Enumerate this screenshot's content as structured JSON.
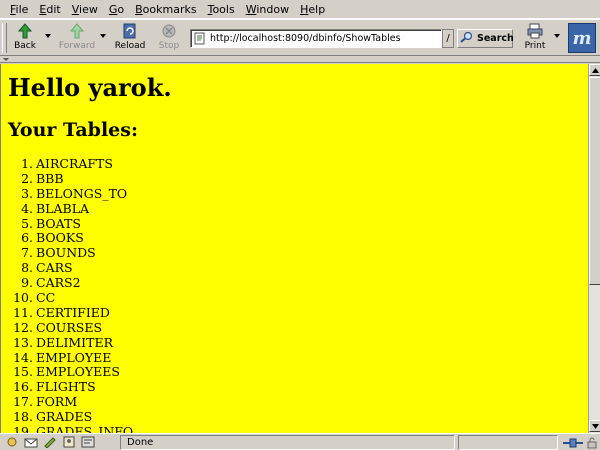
{
  "menu": [
    "File",
    "Edit",
    "View",
    "Go",
    "Bookmarks",
    "Tools",
    "Window",
    "Help"
  ],
  "menu_access_keys": [
    "F",
    "E",
    "V",
    "G",
    "B",
    "T",
    "W",
    "H"
  ],
  "toolbar": {
    "back_label": "Back",
    "forward_label": "Forward",
    "reload_label": "Reload",
    "stop_label": "Stop",
    "search_label": "Search",
    "print_label": "Print"
  },
  "address": {
    "url": "http://localhost:8090/dbinfo/ShowTables"
  },
  "page": {
    "heading": "Hello yarok.",
    "subheading": "Your Tables:",
    "tables": [
      "AIRCRAFTS",
      "BBB",
      "BELONGS_TO",
      "BLABLA",
      "BOATS",
      "BOOKS",
      "BOUNDS",
      "CARS",
      "CARS2",
      "CC",
      "CERTIFIED",
      "COURSES",
      "DELIMITER",
      "EMPLOYEE",
      "EMPLOYEES",
      "FLIGHTS",
      "FORM",
      "GRADES",
      "GRADES_INFO"
    ]
  },
  "status": {
    "text": "Done"
  },
  "colors": {
    "page_background": "#ffff00",
    "chrome": "#d4d0c8"
  },
  "icons": [
    "back-icon",
    "forward-icon",
    "reload-icon",
    "stop-icon",
    "search-icon",
    "print-icon",
    "mozilla-logo"
  ]
}
